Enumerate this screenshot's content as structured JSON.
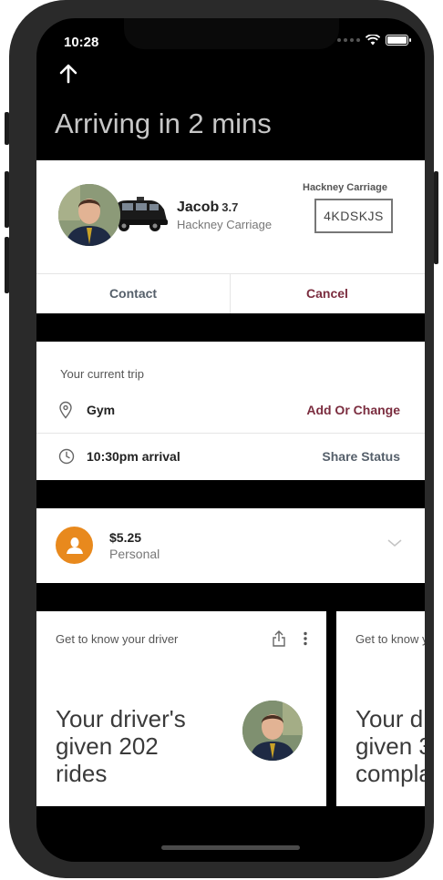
{
  "status": {
    "time": "10:28"
  },
  "header": {
    "title": "Arriving in 2 mins"
  },
  "driver": {
    "name": "Jacob",
    "rating": "3.7",
    "car_type": "Hackney Carriage",
    "plate_label": "Hackney Carriage",
    "plate": "4KDSKJS",
    "contact_label": "Contact",
    "cancel_label": "Cancel"
  },
  "trip": {
    "heading": "Your current trip",
    "destination": "Gym",
    "destination_action": "Add Or Change",
    "arrival": "10:30pm arrival",
    "arrival_action": "Share Status"
  },
  "payment": {
    "amount": "$5.25",
    "type": "Personal"
  },
  "know_cards": [
    {
      "heading": "Get to know your driver",
      "text": [
        "Your driver's",
        "given 202",
        "rides"
      ]
    },
    {
      "heading": "Get to know your driver",
      "text": [
        "Your driver's",
        "given 3",
        "complaints"
      ]
    }
  ],
  "colors": {
    "accent": "#7b2d3f",
    "secondary": "#555f6a",
    "payment": "#e8891d"
  },
  "icons": [
    "up-arrow-icon",
    "wifi-icon",
    "battery-icon",
    "pin-icon",
    "clock-icon",
    "person-icon",
    "chevron-down-icon",
    "share-icon",
    "more-icon"
  ]
}
